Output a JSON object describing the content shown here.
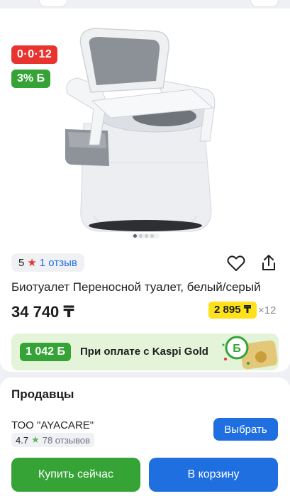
{
  "product": {
    "installment_badge": "0·0·12",
    "bonus_badge": "3% Б",
    "rating": "5",
    "reviews_link": "1 отзыв",
    "title": "Биотуалет Переносной туалет, белый/серый",
    "price": "34 740 ₸",
    "installment_price": "2 895 ₸",
    "installment_months": "×12",
    "gallery_count": 4,
    "gallery_active": 0
  },
  "kaspi_gold": {
    "bonus_amount": "1 042 Б",
    "text": "При оплате с Kaspi Gold",
    "coin_letter": "Б"
  },
  "sellers": {
    "heading": "Продавцы",
    "items": [
      {
        "name": "ТОО \"AYACARE\"",
        "rating": "4.7",
        "reviews": "78 отзывов",
        "choose_label": "Выбрать"
      }
    ]
  },
  "actions": {
    "buy_now": "Купить сейчас",
    "add_to_cart": "В корзину"
  },
  "colors": {
    "red": "#e8342f",
    "green": "#35a335",
    "blue": "#1f6fe0",
    "yellow": "#fce11b"
  },
  "icons": [
    "heart-icon",
    "share-icon",
    "star-icon"
  ]
}
